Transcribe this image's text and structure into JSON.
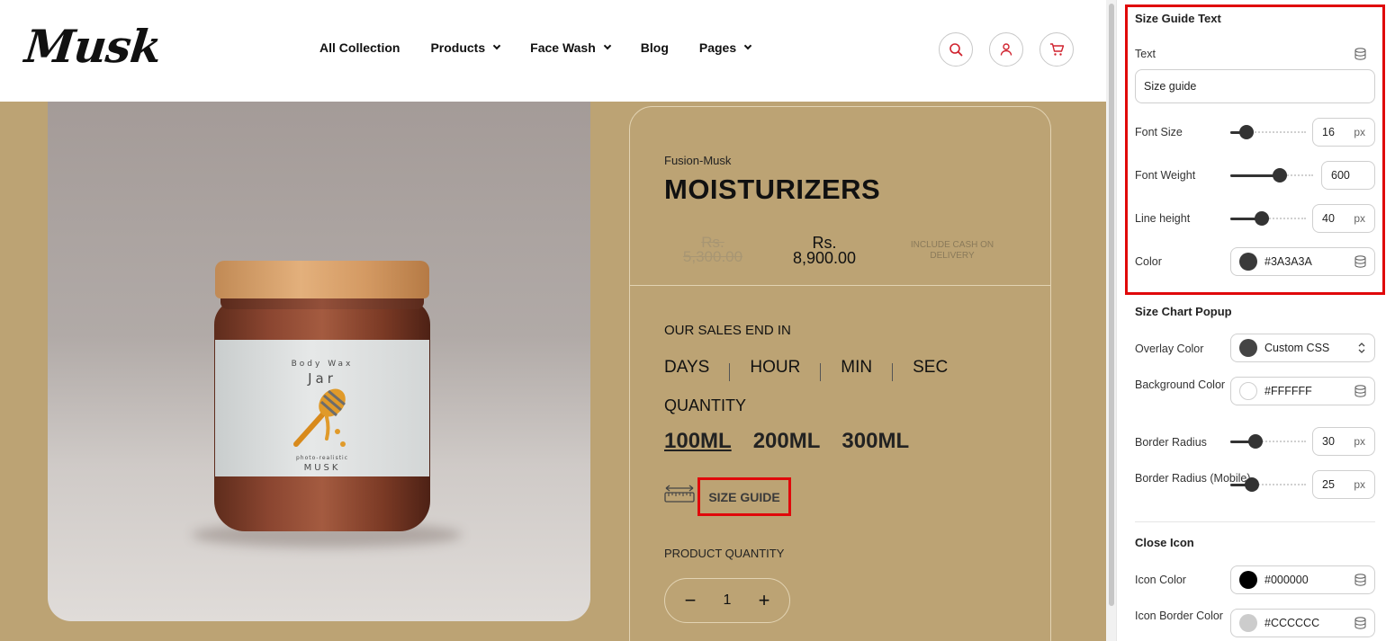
{
  "header": {
    "logo": "Musk",
    "nav": [
      {
        "label": "All Collection",
        "dropdown": false
      },
      {
        "label": "Products",
        "dropdown": true
      },
      {
        "label": "Face Wash",
        "dropdown": true
      },
      {
        "label": "Blog",
        "dropdown": false
      },
      {
        "label": "Pages",
        "dropdown": true
      }
    ],
    "icons": [
      "search-icon",
      "user-icon",
      "cart-icon"
    ],
    "accent_color": "#d0222e"
  },
  "product": {
    "brand": "Fusion-Musk",
    "title": "MOISTURIZERS",
    "old_price": "Rs. 5,300.00",
    "new_price": "Rs. 8,900.00",
    "cash_note": "INCLUDE CASH ON DELIVERY",
    "sales_label": "OUR SALES END IN",
    "countdown": [
      "DAYS",
      "HOUR",
      "MIN",
      "SEC"
    ],
    "quantity_label": "QUANTITY",
    "sizes": [
      "100ML",
      "200ML",
      "300ML"
    ],
    "selected_size": "100ML",
    "size_guide": "SIZE GUIDE",
    "product_quantity_label": "PRODUCT QUANTITY",
    "stepper": {
      "minus": "−",
      "value": "1",
      "plus": "+"
    },
    "jar_label": {
      "line1": "Body Wax",
      "line2": "Jar",
      "line3": "photo-realistic",
      "line4": "MUSK"
    }
  },
  "panel": {
    "size_guide_text": {
      "title": "Size Guide Text",
      "text_label": "Text",
      "text_value": "Size guide",
      "font_size": {
        "label": "Font Size",
        "value": "16",
        "unit": "px",
        "level": 0.22
      },
      "font_weight": {
        "label": "Font Weight",
        "value": "600",
        "level": 0.6
      },
      "line_height": {
        "label": "Line height",
        "value": "40",
        "unit": "px",
        "level": 0.42
      },
      "color": {
        "label": "Color",
        "value": "#3A3A3A",
        "swatch": "#3a3a3a"
      }
    },
    "size_chart_popup": {
      "title": "Size Chart Popup",
      "overlay_color": {
        "label": "Overlay Color",
        "value": "Custom CSS",
        "swatch": "#444444"
      },
      "background_color": {
        "label": "Background Color",
        "value": "#FFFFFF",
        "swatch": "#ffffff"
      },
      "border_radius": {
        "label": "Border Radius",
        "value": "30",
        "unit": "px",
        "level": 0.33
      },
      "border_radius_mobile": {
        "label": "Border Radius (Mobile)",
        "value": "25",
        "unit": "px",
        "level": 0.28
      }
    },
    "close_icon": {
      "title": "Close Icon",
      "icon_color": {
        "label": "Icon Color",
        "value": "#000000",
        "swatch": "#000000"
      },
      "icon_border_color": {
        "label": "Icon Border Color",
        "value": "#CCCCCC",
        "swatch": "#cccccc"
      }
    },
    "highlight_color": "#e0080a"
  }
}
